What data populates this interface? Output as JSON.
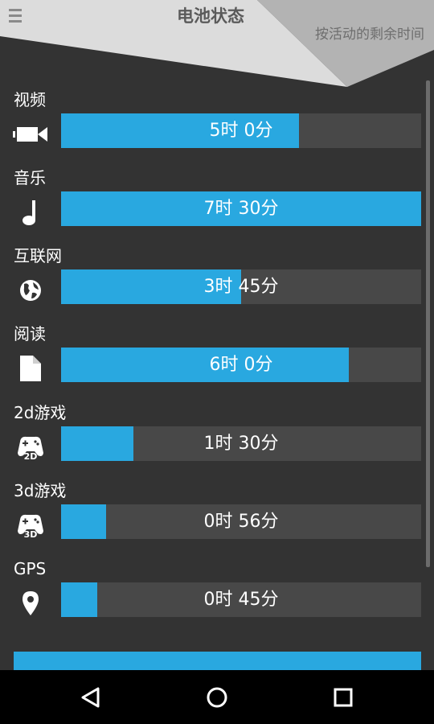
{
  "header": {
    "title": "电池状态",
    "subtitle": "按活动的剩余时间"
  },
  "activities": [
    {
      "label": "视频",
      "time": "5时 0分",
      "level": 0.66,
      "icon": "video-camera-icon"
    },
    {
      "label": "音乐",
      "time": "7时 30分",
      "level": 1.0,
      "icon": "music-note-icon"
    },
    {
      "label": "互联网",
      "time": "3时 45分",
      "level": 0.5,
      "icon": "globe-icon"
    },
    {
      "label": "阅读",
      "time": "6时 0分",
      "level": 0.8,
      "icon": "document-icon"
    },
    {
      "label": "2d游戏",
      "time": "1时 30分",
      "level": 0.2,
      "icon": "gamepad-2d-icon"
    },
    {
      "label": "3d游戏",
      "time": "0时 56分",
      "level": 0.125,
      "icon": "gamepad-3d-icon"
    },
    {
      "label": "GPS",
      "time": "0时 45分",
      "level": 0.1,
      "icon": "location-pin-icon"
    }
  ],
  "colors": {
    "background": "#333333",
    "bar_fill": "#29a8e0",
    "bar_track": "#484848",
    "header_light": "#dcdcdc",
    "header_dark": "#b3b3b3"
  },
  "navbar": {
    "back": "back-triangle-icon",
    "home": "home-circle-icon",
    "recents": "recents-square-icon"
  }
}
